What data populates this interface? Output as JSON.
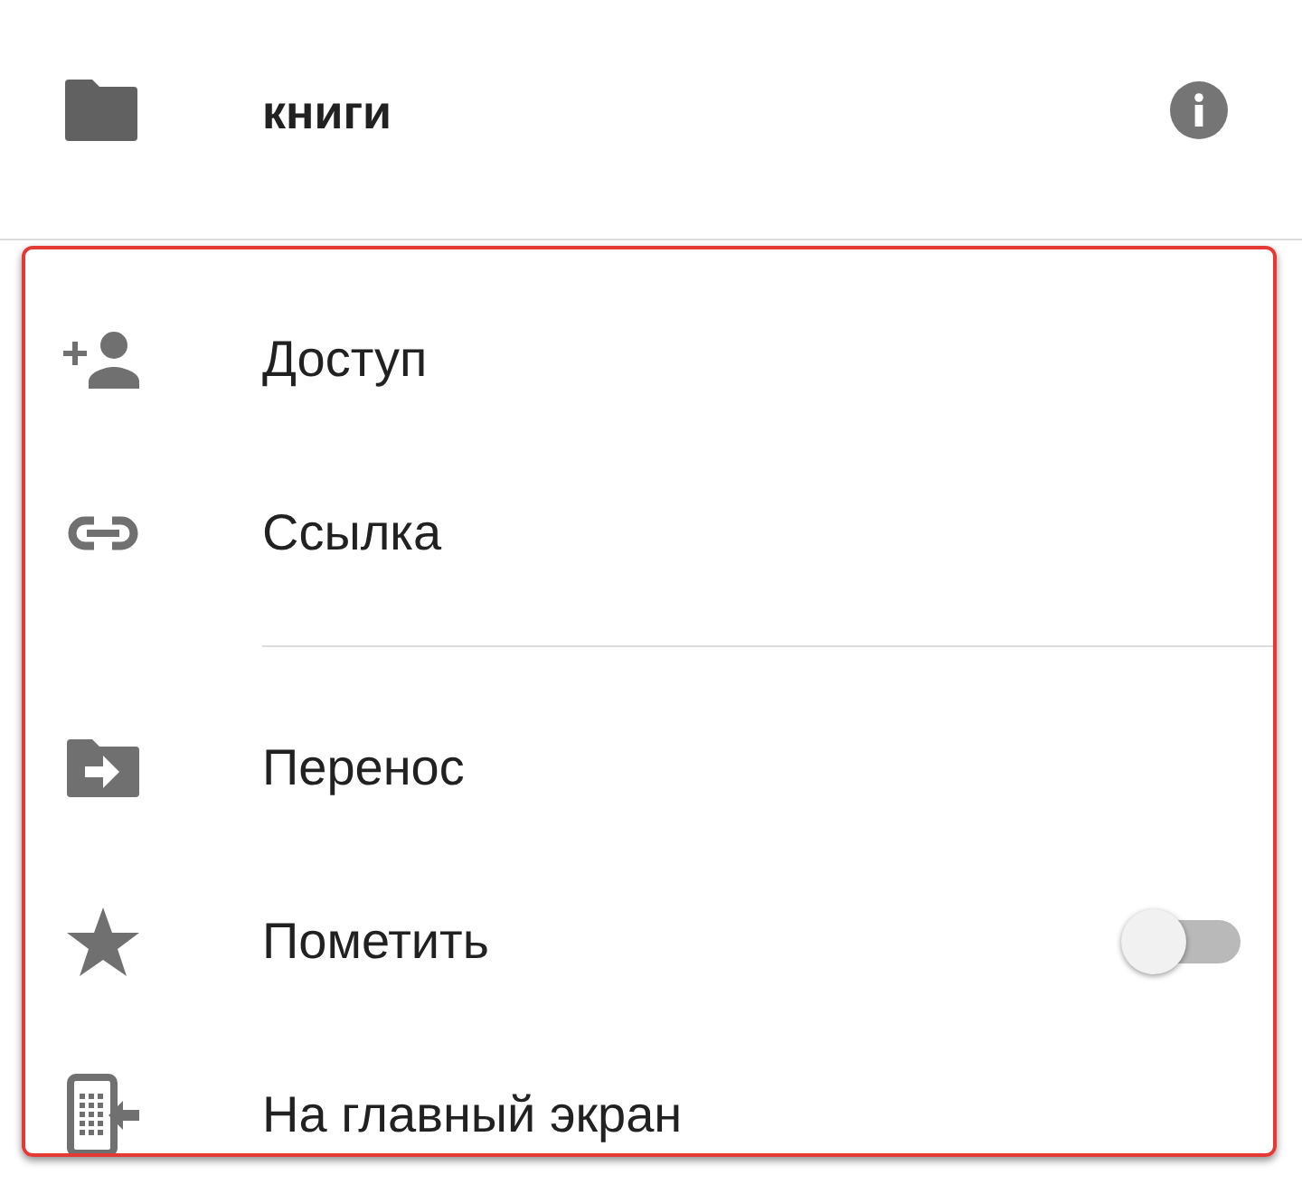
{
  "header": {
    "title": "книги"
  },
  "groups": [
    {
      "items": [
        {
          "kind": "action",
          "label": "Доступ"
        },
        {
          "kind": "action",
          "label": "Ссылка"
        }
      ]
    },
    {
      "items": [
        {
          "kind": "action",
          "label": "Перенос"
        },
        {
          "kind": "toggle",
          "label": "Пометить",
          "on": false
        },
        {
          "kind": "action",
          "label": "На главный экран"
        }
      ]
    }
  ]
}
